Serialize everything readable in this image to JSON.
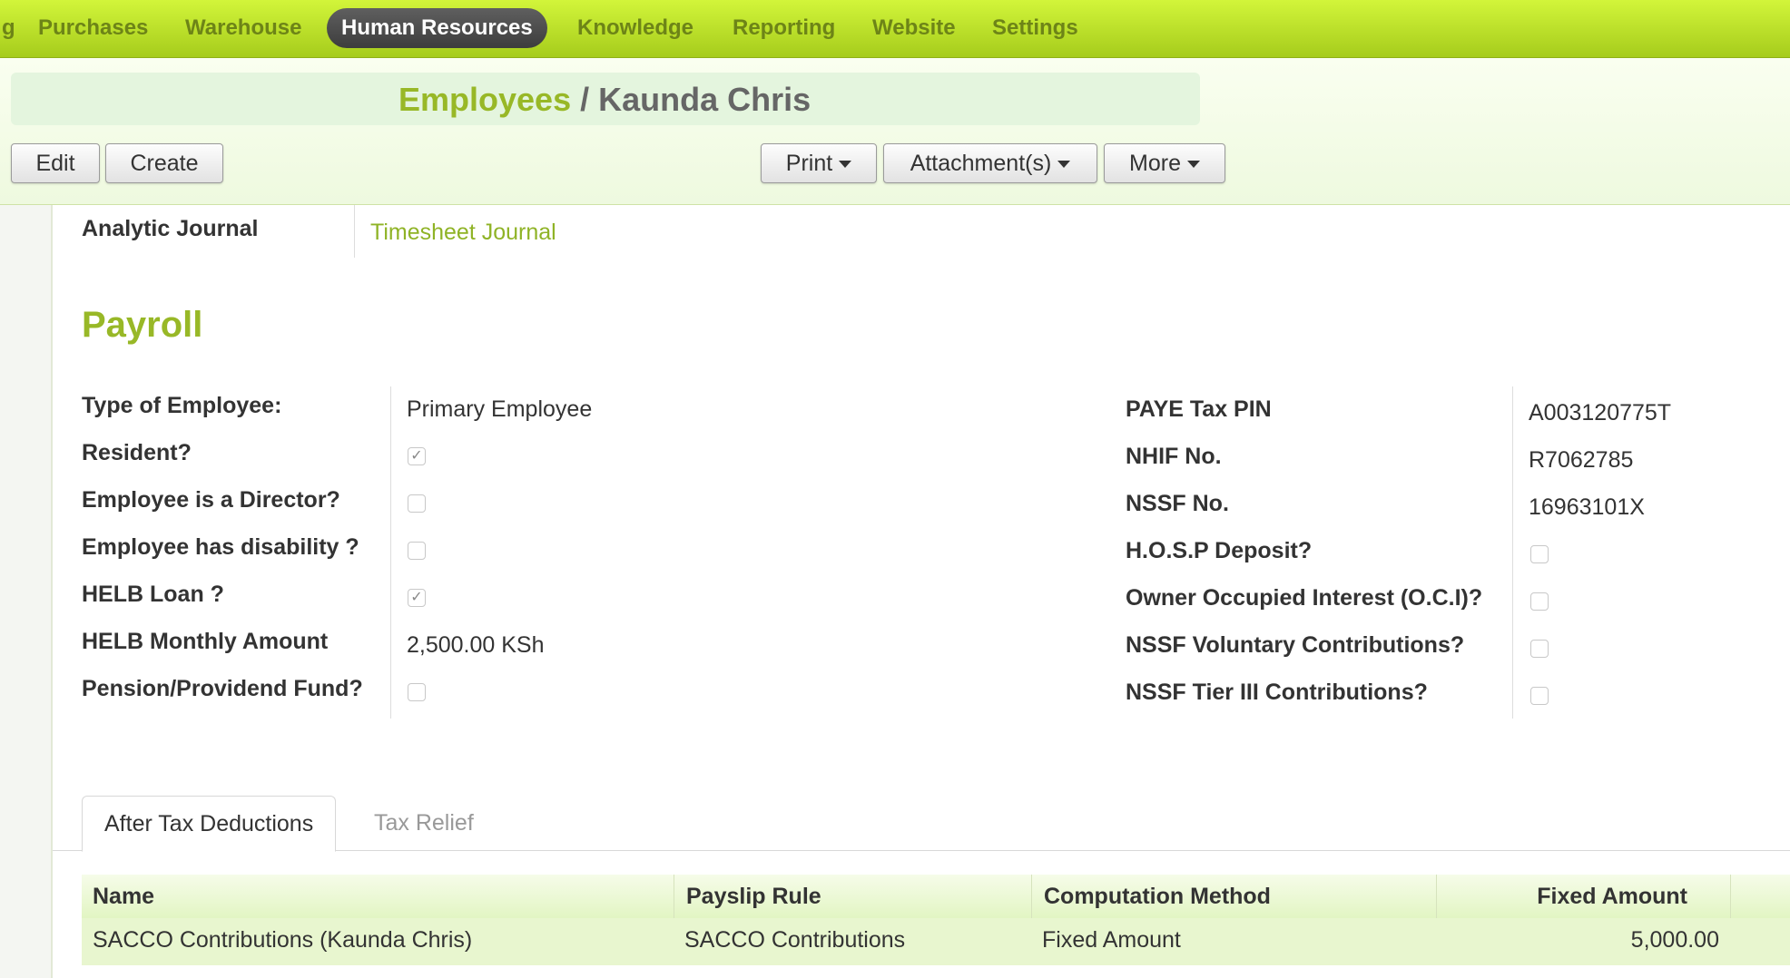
{
  "menu": {
    "items": [
      {
        "label": "g"
      },
      {
        "label": "Purchases"
      },
      {
        "label": "Warehouse"
      },
      {
        "label": "Human Resources",
        "active": true
      },
      {
        "label": "Knowledge"
      },
      {
        "label": "Reporting"
      },
      {
        "label": "Website"
      },
      {
        "label": "Settings"
      }
    ]
  },
  "breadcrumb": {
    "parent": "Employees",
    "separator": " / ",
    "current": "Kaunda Chris"
  },
  "toolbar": {
    "edit": "Edit",
    "create": "Create",
    "print": "Print",
    "attachments": "Attachment(s)",
    "more": "More"
  },
  "form": {
    "analytic_journal": {
      "label": "Analytic Journal",
      "value": "Timesheet Journal"
    },
    "payroll_title": "Payroll",
    "left_fields": [
      {
        "label": "Type of Employee:",
        "value": "Primary Employee"
      },
      {
        "label": "Resident?",
        "checked": true
      },
      {
        "label": "Employee is a Director?",
        "checked": false
      },
      {
        "label": "Employee has disability ?",
        "checked": false
      },
      {
        "label": "HELB Loan ?",
        "checked": true
      },
      {
        "label": "HELB Monthly Amount",
        "value": "2,500.00 KSh"
      },
      {
        "label": "Pension/Providend Fund?",
        "checked": false
      }
    ],
    "right_fields": [
      {
        "label": "PAYE Tax PIN",
        "value": "A003120775T"
      },
      {
        "label": "NHIF No.",
        "value": "R7062785"
      },
      {
        "label": "NSSF No.",
        "value": "16963101X"
      },
      {
        "label": "H.O.S.P Deposit?",
        "checked": false
      },
      {
        "label": "Owner Occupied Interest (O.C.I)?",
        "checked": false
      },
      {
        "label": "NSSF Voluntary Contributions?",
        "checked": false
      },
      {
        "label": "NSSF Tier III Contributions?",
        "checked": false
      }
    ],
    "check_mark": "✓"
  },
  "tabs": [
    {
      "label": "After Tax Deductions",
      "active": true
    },
    {
      "label": "Tax Relief",
      "active": false
    }
  ],
  "table": {
    "columns": [
      "Name",
      "Payslip Rule",
      "Computation Method",
      "Fixed Amount"
    ],
    "rows": [
      [
        "SACCO Contributions (Kaunda Chris)",
        "SACCO Contributions",
        "Fixed Amount",
        "5,000.00"
      ]
    ]
  },
  "colors": {
    "accent_green": "#98b827",
    "topbar_green": "#b7dc26",
    "active_menu": "#4a4a4a"
  }
}
